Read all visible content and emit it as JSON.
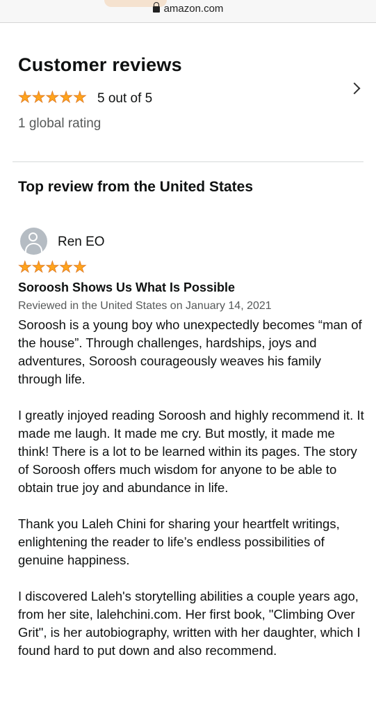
{
  "browser": {
    "url": "amazon.com"
  },
  "reviews": {
    "title": "Customer reviews",
    "average_rating": 5,
    "average_text": "5 out of 5",
    "global_rating": "1 global rating",
    "star_color": "#ffa41c"
  },
  "top_review": {
    "heading": "Top review from the United States",
    "reviewer": "Ren EO",
    "rating": 5,
    "title": "Soroosh Shows Us What Is Possible",
    "meta": "Reviewed in the United States on January 14, 2021",
    "paragraphs": [
      "Soroosh is a young boy who unexpectedly becomes “man of the house”. Through challenges, hardships, joys and adventures, Soroosh courageously weaves his family through life.",
      "I greatly injoyed reading Soroosh and highly recommend it. It made me laugh. It made me cry. But mostly, it made me think! There is a lot to be learned within its pages. The story of Soroosh offers much wisdom for anyone to be able to obtain true joy and abundance in life.",
      "Thank you Laleh Chini for sharing your heartfelt writings, enlightening the reader to life’s endless possibilities of genuine happiness.",
      "I discovered Laleh's storytelling abilities a couple years ago, from her site, lalehchini.com. Her first book, \"Climbing Over Grit\", is her autobiography, written with her daughter, which I found hard to put down and also recommend."
    ]
  }
}
